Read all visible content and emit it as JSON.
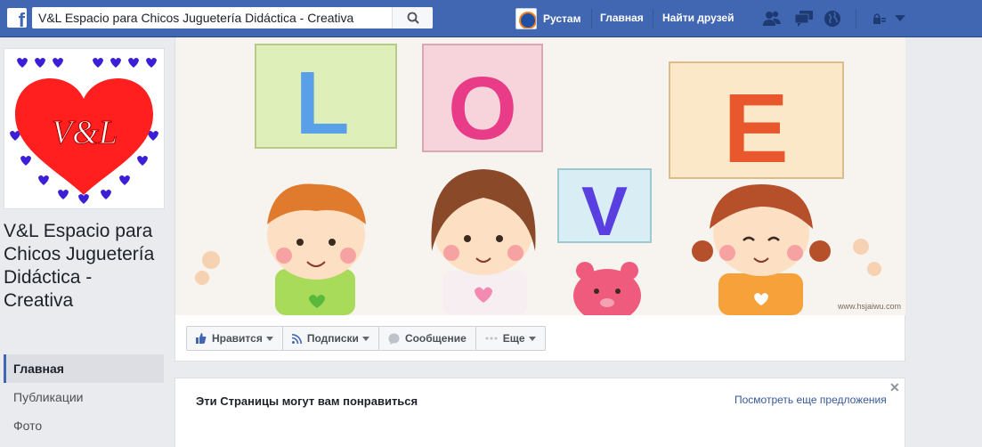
{
  "header": {
    "logo_letter": "f",
    "search_value": "V&L Espacio para Chicos Juguetería Didáctica - Creativa",
    "user_name": "Рустам",
    "nav_home": "Главная",
    "nav_find_friends": "Найти друзей",
    "brand_color": "#4267b2"
  },
  "page": {
    "name": "V&L Espacio para Chicos Juguetería Didáctica - Creativa",
    "logo_text": "V&L",
    "cover_letters": [
      "L",
      "O",
      "V",
      "E"
    ],
    "cover_watermark": "www.hsjaiwu.com",
    "actions": [
      {
        "label": "Нравится",
        "icon": "thumbs-up-icon",
        "caret": true
      },
      {
        "label": "Подписки",
        "icon": "rss-icon",
        "caret": true
      },
      {
        "label": "Сообщение",
        "icon": "message-icon",
        "caret": false
      },
      {
        "label": "Еще",
        "icon": "more-icon",
        "caret": true
      }
    ]
  },
  "left_nav": [
    {
      "label": "Главная",
      "active": true
    },
    {
      "label": "Публикации",
      "active": false
    },
    {
      "label": "Фото",
      "active": false
    }
  ],
  "suggestions": {
    "title": "Эти Страницы могут вам понравиться",
    "see_more": "Посмотреть еще предложения",
    "close_glyph": "✕"
  }
}
